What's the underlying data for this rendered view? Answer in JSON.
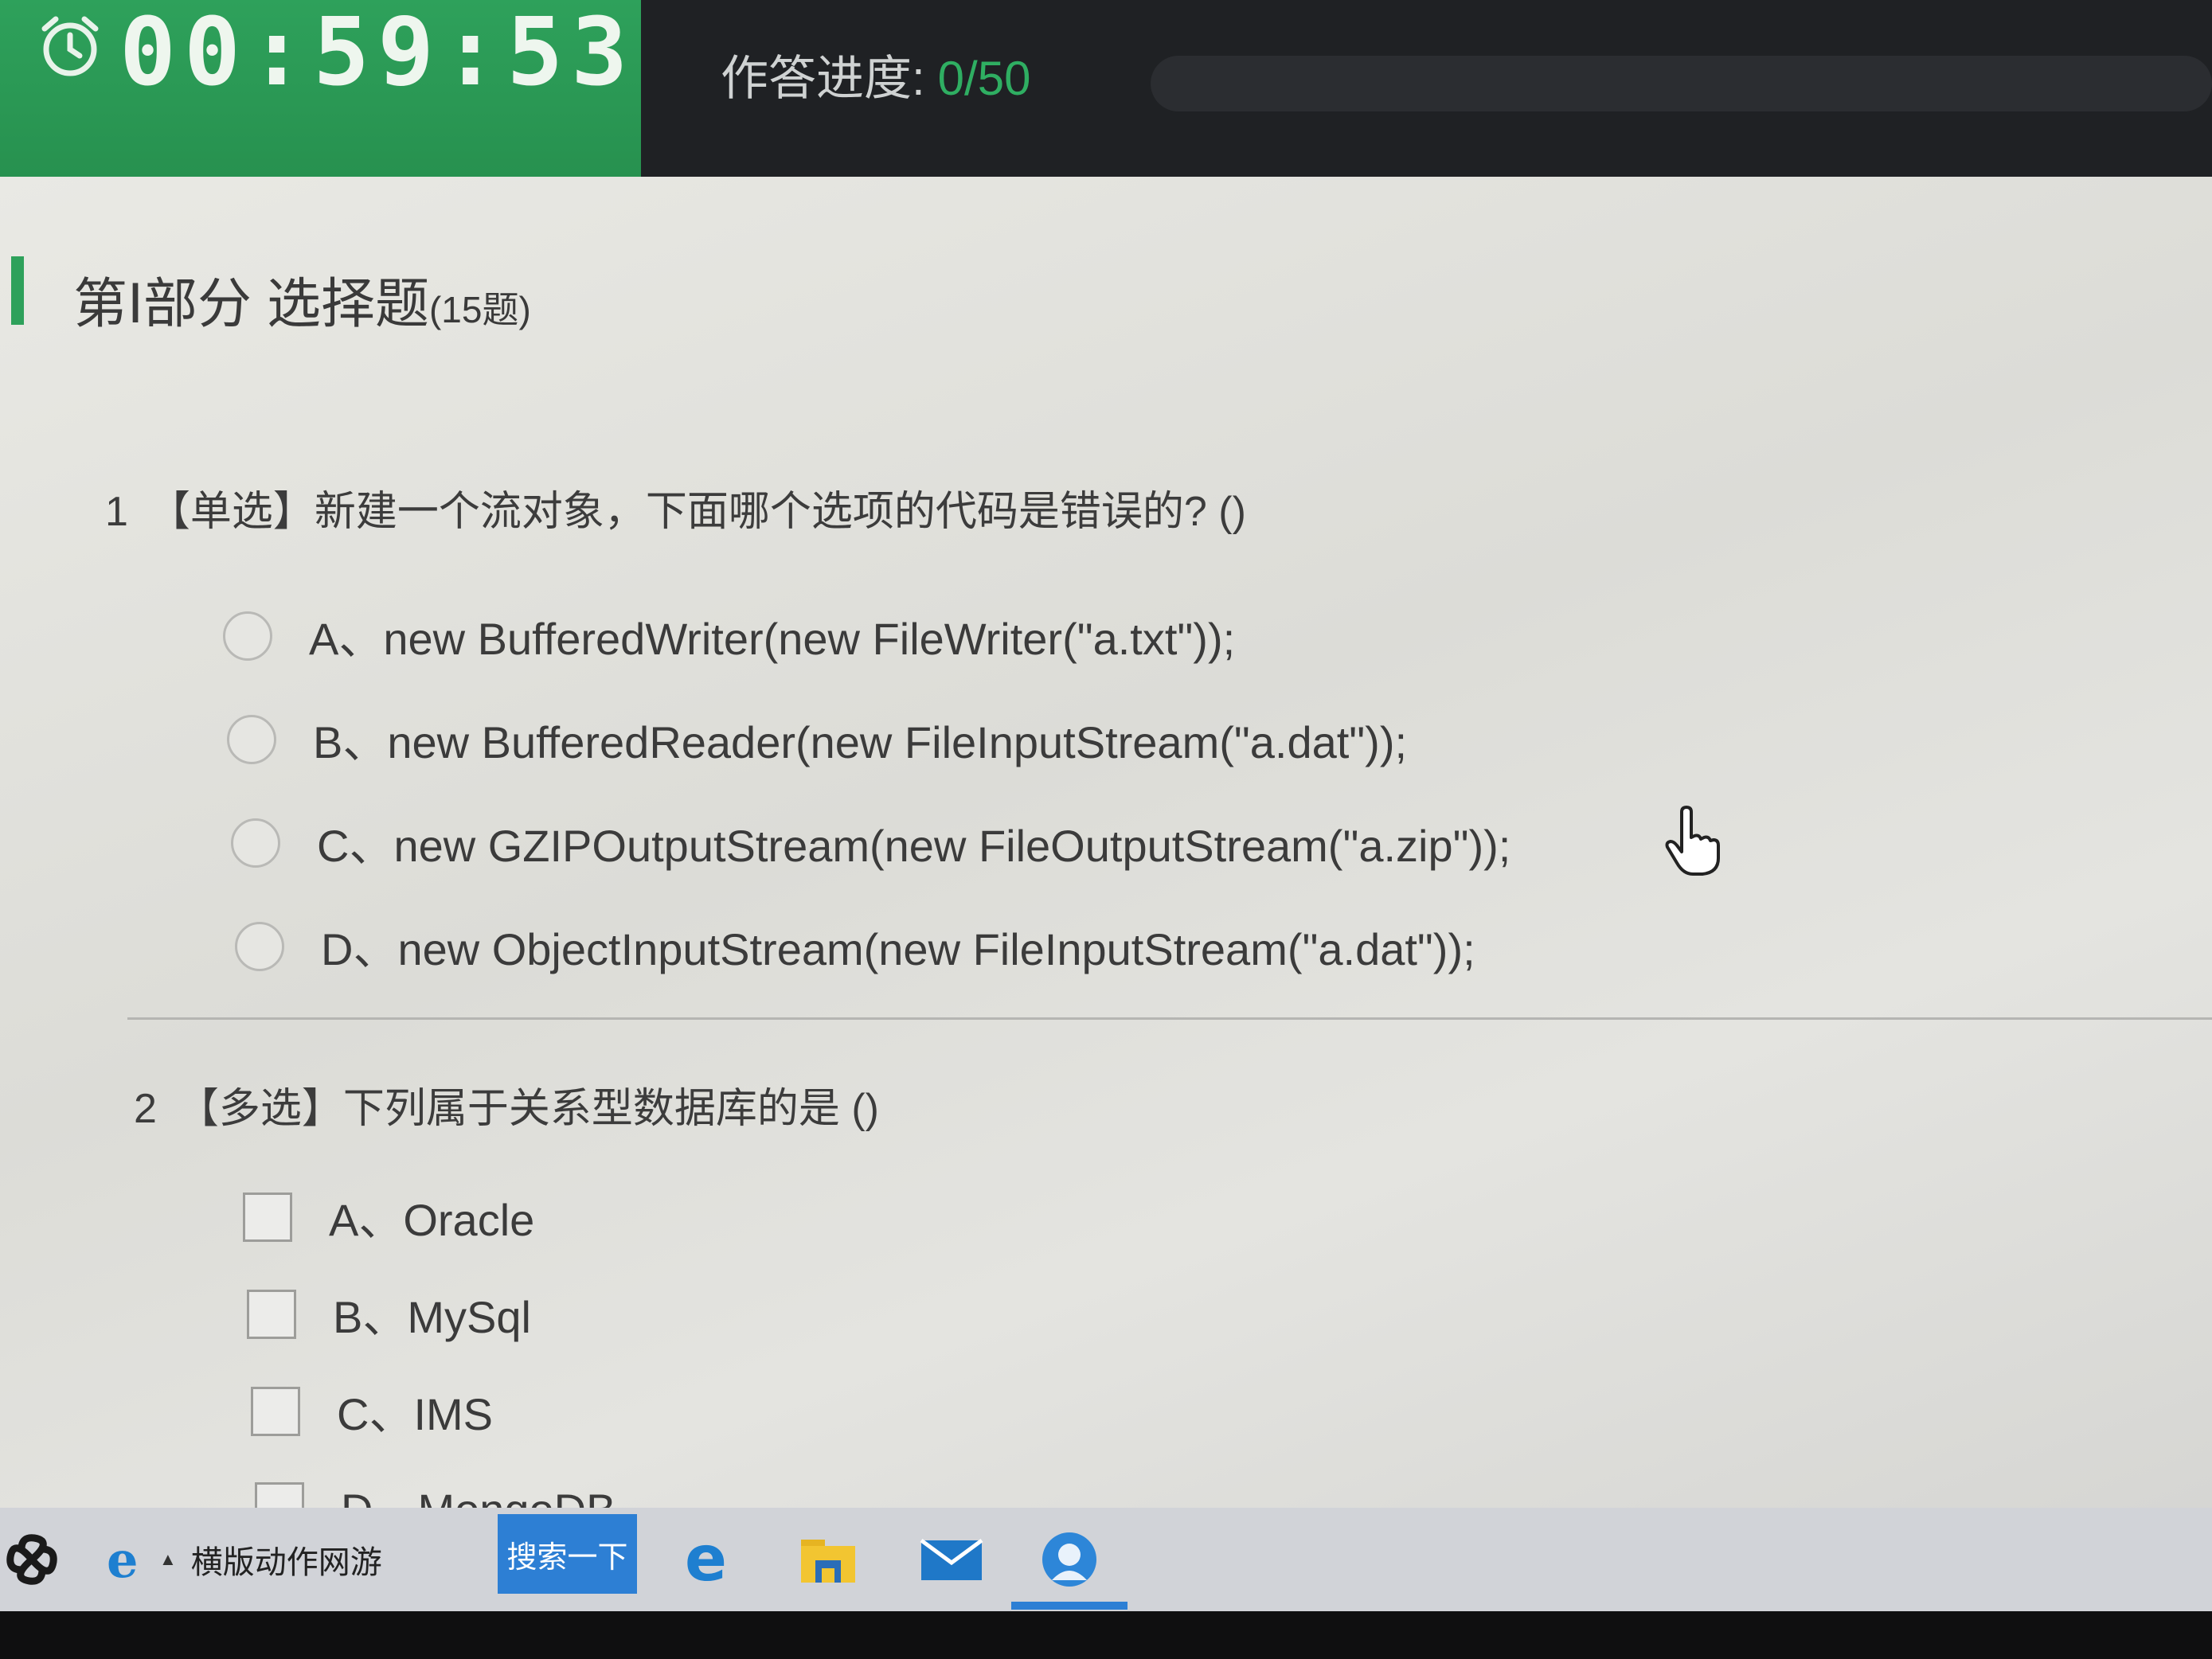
{
  "header": {
    "timer": "00:59:53",
    "progress_label": "作答进度:",
    "progress_value": "0/50"
  },
  "section": {
    "title": "第Ⅰ部分  选择题",
    "count": "(15题)"
  },
  "questions": [
    {
      "number": "1",
      "text": "【单选】新建一个流对象，下面哪个选项的代码是错误的?  ()",
      "type": "single",
      "options": [
        "A、new BufferedWriter(new FileWriter(\"a.txt\"));",
        "B、new BufferedReader(new FileInputStream(\"a.dat\"));",
        "C、new GZIPOutputStream(new FileOutputStream(\"a.zip\"));",
        "D、new ObjectInputStream(new FileInputStream(\"a.dat\"));"
      ]
    },
    {
      "number": "2",
      "text": "【多选】下列属于关系型数据库的是 ()",
      "type": "multiple",
      "options": [
        "A、Oracle",
        "B、MySql",
        "C、IMS",
        "D、MongoDB"
      ]
    }
  ],
  "taskbar": {
    "search_text": "横版动作网游",
    "search_button": "搜索一下"
  },
  "colors": {
    "accent_green": "#2ea15b",
    "header_dark": "#1f2124",
    "taskbar_blue": "#2d7fd4"
  },
  "icons": [
    "clock-icon",
    "hand-cursor-icon",
    "start-logo-icon",
    "ie-icon",
    "edge-icon",
    "file-explorer-icon",
    "mail-icon",
    "user-app-icon"
  ]
}
